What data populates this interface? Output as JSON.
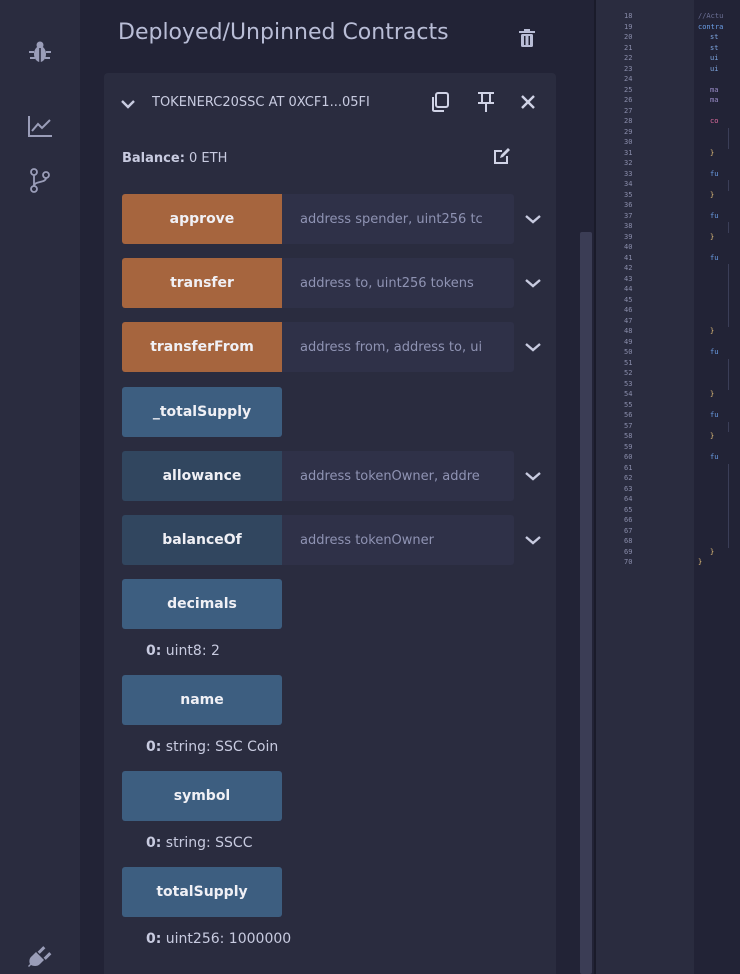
{
  "sidebar": {
    "icons": [
      "debug-icon",
      "chart-icon",
      "git-branch-icon",
      "plug-icon"
    ]
  },
  "panel": {
    "title": "Deployed/Unpinned Contracts",
    "contract": {
      "name": "TOKENERC20SSC AT 0XCF1...05FI",
      "balance_label": "Balance:",
      "balance_value": "0 ETH"
    },
    "functions": [
      {
        "name": "approve",
        "placeholder": "address spender, uint256 tc"
      },
      {
        "name": "transfer",
        "placeholder": "address to, uint256 tokens"
      },
      {
        "name": "transferFrom",
        "placeholder": "address from, address to, ui"
      },
      {
        "name": "_totalSupply"
      },
      {
        "name": "allowance",
        "placeholder": "address tokenOwner, addre"
      },
      {
        "name": "balanceOf",
        "placeholder": "address tokenOwner"
      },
      {
        "name": "decimals",
        "result_index": "0:",
        "result": "uint8: 2"
      },
      {
        "name": "name",
        "result_index": "0:",
        "result": "string: SSC Coin"
      },
      {
        "name": "symbol",
        "result_index": "0:",
        "result": "string: SSCC"
      },
      {
        "name": "totalSupply",
        "result_index": "0:",
        "result": "uint256: 1000000"
      }
    ]
  },
  "editor": {
    "line_numbers": [
      "18",
      "19",
      "20",
      "21",
      "22",
      "23",
      "24",
      "25",
      "26",
      "27",
      "28",
      "29",
      "30",
      "31",
      "32",
      "33",
      "34",
      "35",
      "36",
      "37",
      "38",
      "39",
      "40",
      "41",
      "42",
      "43",
      "44",
      "45",
      "46",
      "47",
      "48",
      "49",
      "50",
      "51",
      "52",
      "53",
      "54",
      "55",
      "56",
      "57",
      "58",
      "59",
      "60",
      "61",
      "62",
      "63",
      "64",
      "65",
      "66",
      "67",
      "68",
      "69",
      "70"
    ],
    "code": {
      "l18": "//Actu",
      "l19": "contra",
      "l20": "st",
      "l21": "st",
      "l22": "ui",
      "l23": "ui",
      "l25": "ma",
      "l26": "ma",
      "l28": "co",
      "l31": "}",
      "l33": "fu",
      "l35": "}",
      "l37": "fu",
      "l39": "}",
      "l41": "fu",
      "l48": "}",
      "l50": "fu",
      "l54": "}",
      "l56": "fu",
      "l58": "}",
      "l60": "fu",
      "l69": "}",
      "l70": "}"
    }
  },
  "colors": {
    "orange_button": "#a6653e",
    "blue_button": "#3d5e80",
    "dark_blue_button": "#31465f",
    "background": "#222336",
    "panel": "#2a2c3f"
  }
}
